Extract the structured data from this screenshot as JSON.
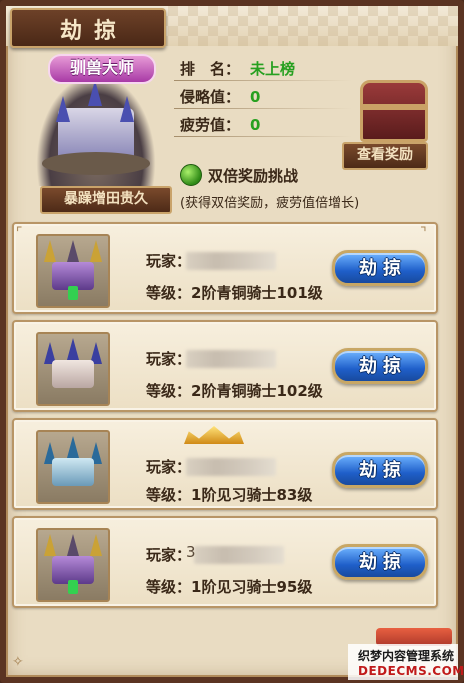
{
  "window": {
    "title": "劫掠"
  },
  "profile": {
    "badge": "驯兽大师",
    "name": "暴躁增田贵久",
    "stats": [
      {
        "label": "排　名：",
        "value": "未上榜"
      },
      {
        "label": "侵略值：",
        "value": "0"
      },
      {
        "label": "疲劳值：",
        "value": "0"
      }
    ],
    "reward_button": "查看奖励",
    "double_reward_label": "双倍奖励挑战",
    "double_reward_hint": "(获得双倍奖励，疲劳值倍增长)"
  },
  "targets": [
    {
      "player_label": "玩家：",
      "player_name": "",
      "level_label": "等级：",
      "level": "2阶青铜骑士101级",
      "button": "劫掠",
      "has_crown": false,
      "castle": "purple"
    },
    {
      "player_label": "玩家：",
      "player_name": "",
      "level_label": "等级：",
      "level": "2阶青铜骑士102级",
      "button": "劫掠",
      "has_crown": false,
      "castle": "white"
    },
    {
      "player_label": "玩家：",
      "player_name": "",
      "level_label": "等级：",
      "level": "1阶见习骑士83级",
      "button": "劫掠",
      "has_crown": true,
      "castle": "blue"
    },
    {
      "player_label": "玩家：",
      "player_name": "3",
      "level_label": "等级：",
      "level": "1阶见习骑士95级",
      "button": "劫掠",
      "has_crown": false,
      "castle": "purple"
    }
  ],
  "watermark": {
    "line1": "织梦内容管理系统",
    "line2": "DEDECMS.COM"
  },
  "colors": {
    "value_green": "#27a020",
    "button_blue": "#1f5fc9",
    "frame_brown": "#5b3422"
  }
}
